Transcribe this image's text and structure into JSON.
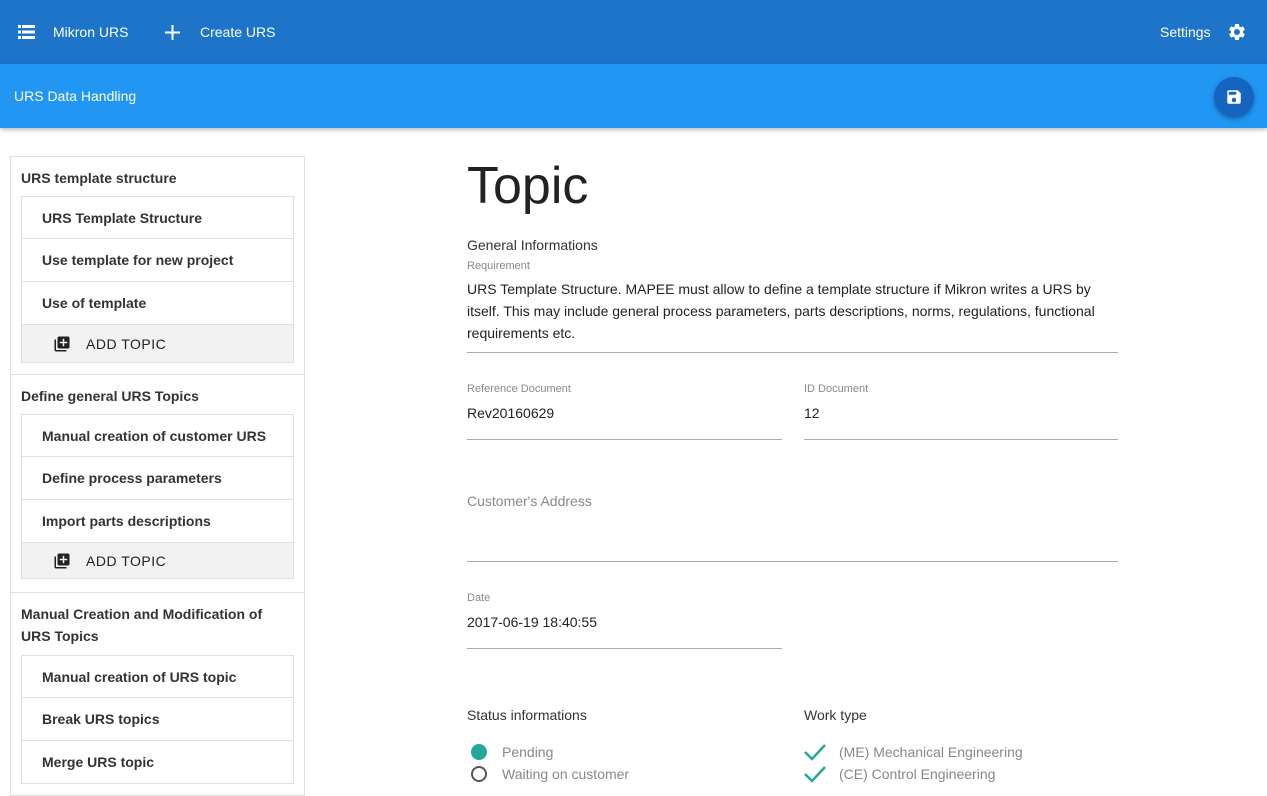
{
  "topbar": {
    "app_name": "Mikron URS",
    "create_label": "Create URS",
    "settings_label": "Settings"
  },
  "subbar": {
    "title": "URS Data Handling"
  },
  "sidebar": {
    "sections": [
      {
        "title": "URS template structure",
        "topics": [
          "URS Template Structure",
          "Use template for new project",
          "Use of template"
        ],
        "add_label": "ADD TOPIC"
      },
      {
        "title": "Define general URS Topics",
        "topics": [
          "Manual creation of customer URS",
          "Define process parameters",
          "Import parts descriptions"
        ],
        "add_label": "ADD TOPIC"
      },
      {
        "title": "Manual Creation and Modification of URS Topics",
        "topics": [
          "Manual creation of URS topic",
          "Break URS topics",
          "Merge URS topic"
        ]
      }
    ]
  },
  "main": {
    "heading": "Topic",
    "general_label": "General Informations",
    "requirement_label": "Requirement",
    "requirement_value": "URS Template Structure. MAPEE must allow to define a template structure if Mikron writes a URS by itself. This may include general process parameters, parts descriptions, norms, regulations, functional requirements etc.",
    "reference_label": "Reference Document",
    "reference_value": "Rev20160629",
    "id_label": "ID Document",
    "id_value": "12",
    "address_placeholder": "Customer's Address",
    "date_label": "Date",
    "date_value": "2017-06-19 18:40:55",
    "status_label": "Status informations",
    "status_options": [
      {
        "label": "Pending",
        "selected": true
      },
      {
        "label": "Waiting on customer",
        "selected": false
      }
    ],
    "worktype_label": "Work type",
    "worktype_options": [
      {
        "label": "(ME) Mechanical Engineering",
        "checked": true
      },
      {
        "label": "(CE) Control Engineering",
        "checked": true
      }
    ]
  },
  "colors": {
    "topbar": "#1d74c8",
    "subbar": "#2196f3",
    "accent": "#26a69a"
  },
  "icons": {
    "menu": "list-icon",
    "create": "plus-icon",
    "settings": "gear-icon",
    "save": "floppy-disk-icon",
    "add_topic": "add-to-queue-icon"
  }
}
